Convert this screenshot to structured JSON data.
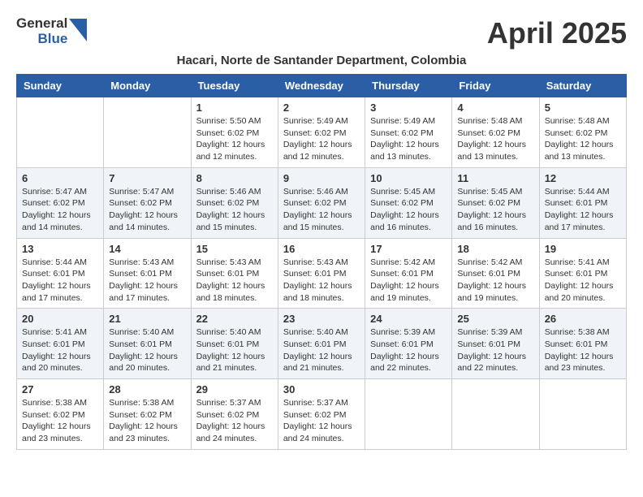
{
  "logo": {
    "general": "General",
    "blue": "Blue"
  },
  "title": "April 2025",
  "location": "Hacari, Norte de Santander Department, Colombia",
  "days_of_week": [
    "Sunday",
    "Monday",
    "Tuesday",
    "Wednesday",
    "Thursday",
    "Friday",
    "Saturday"
  ],
  "weeks": [
    [
      {
        "day": "",
        "info": ""
      },
      {
        "day": "",
        "info": ""
      },
      {
        "day": "1",
        "info": "Sunrise: 5:50 AM\nSunset: 6:02 PM\nDaylight: 12 hours and 12 minutes."
      },
      {
        "day": "2",
        "info": "Sunrise: 5:49 AM\nSunset: 6:02 PM\nDaylight: 12 hours and 12 minutes."
      },
      {
        "day": "3",
        "info": "Sunrise: 5:49 AM\nSunset: 6:02 PM\nDaylight: 12 hours and 13 minutes."
      },
      {
        "day": "4",
        "info": "Sunrise: 5:48 AM\nSunset: 6:02 PM\nDaylight: 12 hours and 13 minutes."
      },
      {
        "day": "5",
        "info": "Sunrise: 5:48 AM\nSunset: 6:02 PM\nDaylight: 12 hours and 13 minutes."
      }
    ],
    [
      {
        "day": "6",
        "info": "Sunrise: 5:47 AM\nSunset: 6:02 PM\nDaylight: 12 hours and 14 minutes."
      },
      {
        "day": "7",
        "info": "Sunrise: 5:47 AM\nSunset: 6:02 PM\nDaylight: 12 hours and 14 minutes."
      },
      {
        "day": "8",
        "info": "Sunrise: 5:46 AM\nSunset: 6:02 PM\nDaylight: 12 hours and 15 minutes."
      },
      {
        "day": "9",
        "info": "Sunrise: 5:46 AM\nSunset: 6:02 PM\nDaylight: 12 hours and 15 minutes."
      },
      {
        "day": "10",
        "info": "Sunrise: 5:45 AM\nSunset: 6:02 PM\nDaylight: 12 hours and 16 minutes."
      },
      {
        "day": "11",
        "info": "Sunrise: 5:45 AM\nSunset: 6:02 PM\nDaylight: 12 hours and 16 minutes."
      },
      {
        "day": "12",
        "info": "Sunrise: 5:44 AM\nSunset: 6:01 PM\nDaylight: 12 hours and 17 minutes."
      }
    ],
    [
      {
        "day": "13",
        "info": "Sunrise: 5:44 AM\nSunset: 6:01 PM\nDaylight: 12 hours and 17 minutes."
      },
      {
        "day": "14",
        "info": "Sunrise: 5:43 AM\nSunset: 6:01 PM\nDaylight: 12 hours and 17 minutes."
      },
      {
        "day": "15",
        "info": "Sunrise: 5:43 AM\nSunset: 6:01 PM\nDaylight: 12 hours and 18 minutes."
      },
      {
        "day": "16",
        "info": "Sunrise: 5:43 AM\nSunset: 6:01 PM\nDaylight: 12 hours and 18 minutes."
      },
      {
        "day": "17",
        "info": "Sunrise: 5:42 AM\nSunset: 6:01 PM\nDaylight: 12 hours and 19 minutes."
      },
      {
        "day": "18",
        "info": "Sunrise: 5:42 AM\nSunset: 6:01 PM\nDaylight: 12 hours and 19 minutes."
      },
      {
        "day": "19",
        "info": "Sunrise: 5:41 AM\nSunset: 6:01 PM\nDaylight: 12 hours and 20 minutes."
      }
    ],
    [
      {
        "day": "20",
        "info": "Sunrise: 5:41 AM\nSunset: 6:01 PM\nDaylight: 12 hours and 20 minutes."
      },
      {
        "day": "21",
        "info": "Sunrise: 5:40 AM\nSunset: 6:01 PM\nDaylight: 12 hours and 20 minutes."
      },
      {
        "day": "22",
        "info": "Sunrise: 5:40 AM\nSunset: 6:01 PM\nDaylight: 12 hours and 21 minutes."
      },
      {
        "day": "23",
        "info": "Sunrise: 5:40 AM\nSunset: 6:01 PM\nDaylight: 12 hours and 21 minutes."
      },
      {
        "day": "24",
        "info": "Sunrise: 5:39 AM\nSunset: 6:01 PM\nDaylight: 12 hours and 22 minutes."
      },
      {
        "day": "25",
        "info": "Sunrise: 5:39 AM\nSunset: 6:01 PM\nDaylight: 12 hours and 22 minutes."
      },
      {
        "day": "26",
        "info": "Sunrise: 5:38 AM\nSunset: 6:01 PM\nDaylight: 12 hours and 23 minutes."
      }
    ],
    [
      {
        "day": "27",
        "info": "Sunrise: 5:38 AM\nSunset: 6:02 PM\nDaylight: 12 hours and 23 minutes."
      },
      {
        "day": "28",
        "info": "Sunrise: 5:38 AM\nSunset: 6:02 PM\nDaylight: 12 hours and 23 minutes."
      },
      {
        "day": "29",
        "info": "Sunrise: 5:37 AM\nSunset: 6:02 PM\nDaylight: 12 hours and 24 minutes."
      },
      {
        "day": "30",
        "info": "Sunrise: 5:37 AM\nSunset: 6:02 PM\nDaylight: 12 hours and 24 minutes."
      },
      {
        "day": "",
        "info": ""
      },
      {
        "day": "",
        "info": ""
      },
      {
        "day": "",
        "info": ""
      }
    ]
  ]
}
